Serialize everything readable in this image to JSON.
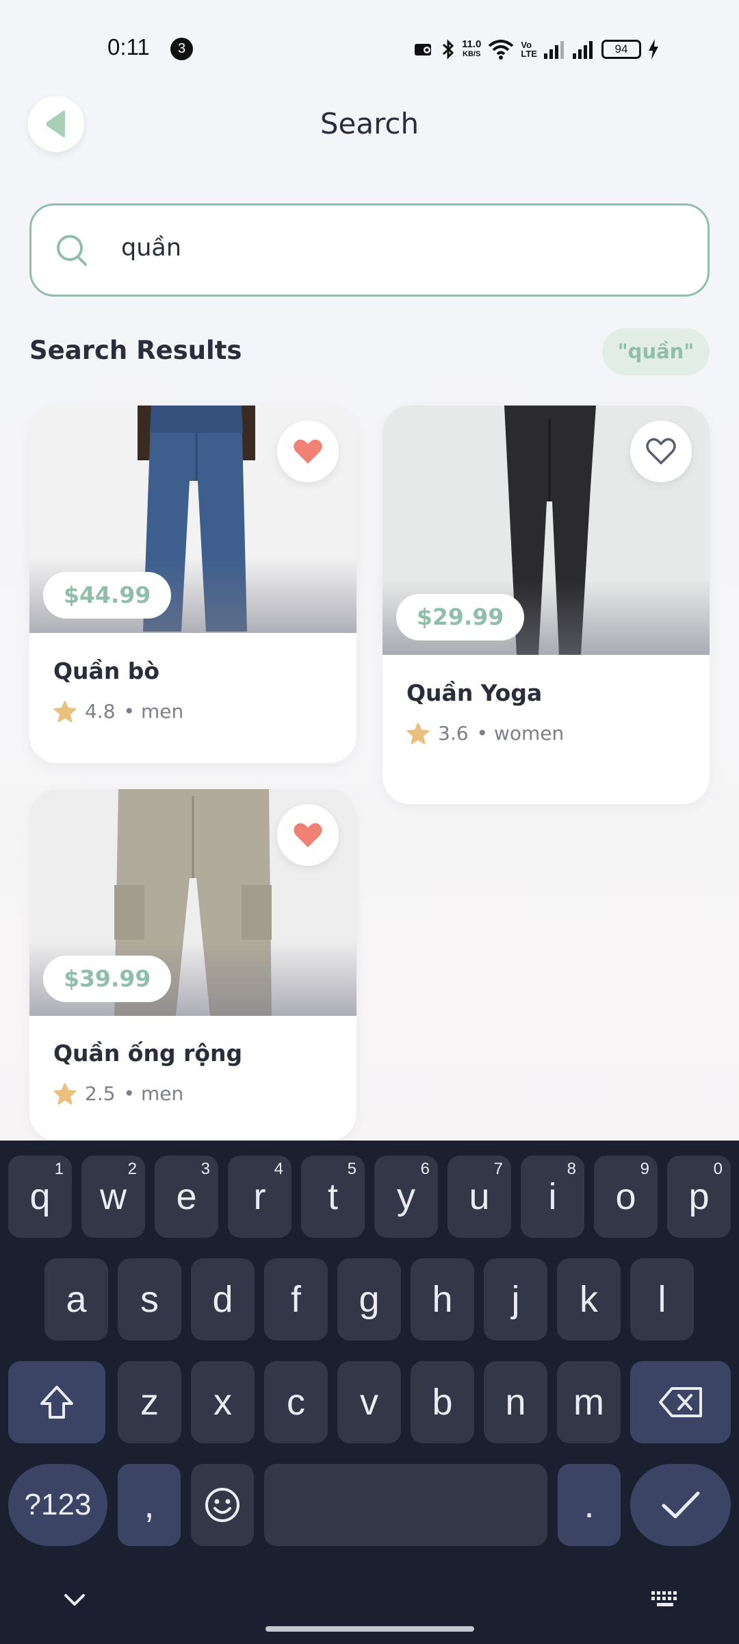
{
  "status_bar": {
    "time": "0:11",
    "notification_count": "3",
    "net_speed_value": "11.0",
    "net_speed_unit": "KB/S",
    "volte_top": "Vo",
    "volte_bottom": "LTE",
    "battery": "94"
  },
  "header": {
    "title": "Search",
    "back_icon": "back-arrow-icon"
  },
  "search": {
    "query": "quần",
    "icon": "search-icon"
  },
  "results": {
    "heading": "Search Results",
    "query_chip": "\"quần\"",
    "items": [
      {
        "name": "Quần bò",
        "price": "$44.99",
        "rating": "4.8",
        "category": "• men",
        "favorited": true
      },
      {
        "name": "Quần Yoga",
        "price": "$29.99",
        "rating": "3.6",
        "category": "• women",
        "favorited": false
      },
      {
        "name": "Quần ống rộng",
        "price": "$39.99",
        "rating": "2.5",
        "category": "• men",
        "favorited": true
      }
    ]
  },
  "keyboard": {
    "row1": [
      {
        "k": "q",
        "h": "1"
      },
      {
        "k": "w",
        "h": "2"
      },
      {
        "k": "e",
        "h": "3"
      },
      {
        "k": "r",
        "h": "4"
      },
      {
        "k": "t",
        "h": "5"
      },
      {
        "k": "y",
        "h": "6"
      },
      {
        "k": "u",
        "h": "7"
      },
      {
        "k": "i",
        "h": "8"
      },
      {
        "k": "o",
        "h": "9"
      },
      {
        "k": "p",
        "h": "0"
      }
    ],
    "row2": [
      "a",
      "s",
      "d",
      "f",
      "g",
      "h",
      "j",
      "k",
      "l"
    ],
    "row3": [
      "z",
      "x",
      "c",
      "v",
      "b",
      "n",
      "m"
    ],
    "symbols_key": "?123",
    "comma_key": ",",
    "period_key": "."
  },
  "colors": {
    "accent": "#8fbfaa",
    "heart": "#ef8273",
    "star": "#eac07e",
    "keyboard_bg": "#1b2030"
  }
}
